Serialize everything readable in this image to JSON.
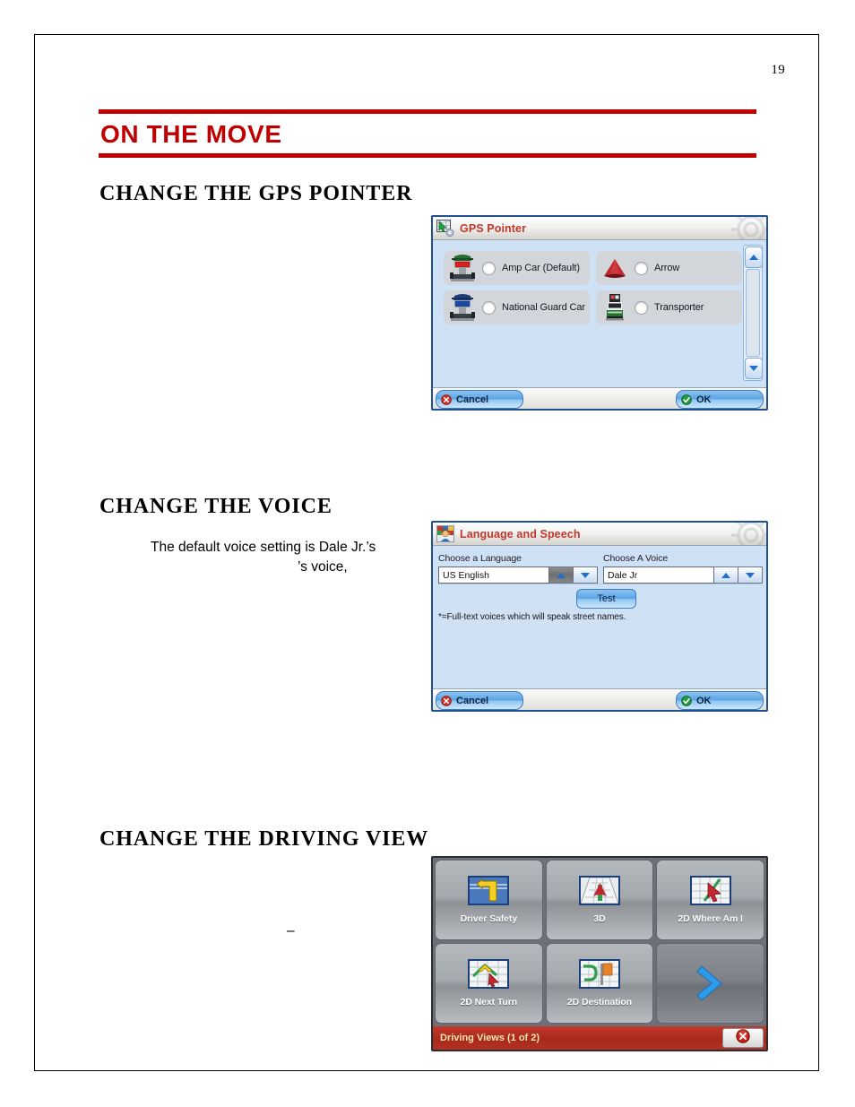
{
  "document": {
    "page_number": "19",
    "chapter_title": "ON THE MOVE",
    "sections": [
      {
        "heading": "CHANGE THE GPS POINTER"
      },
      {
        "heading": "CHANGE THE VOICE"
      },
      {
        "heading": "CHANGE THE DRIVING VIEW"
      }
    ],
    "body": {
      "voice_line_1": "The default voice setting is Dale Jr.’s",
      "voice_line_2": "’s voice,",
      "driving_view_dash": "–"
    },
    "accent_color": "#c00000",
    "rule_color": "#c00000"
  },
  "gps_pointer_dialog": {
    "title": "GPS Pointer",
    "title_icon": "map-pointer-gear-icon",
    "decoration_icon": "gear-icon",
    "options": [
      {
        "label": "Amp Car (Default)",
        "icon": "amp-car-icon",
        "selected": false
      },
      {
        "label": "Arrow",
        "icon": "red-arrow-icon",
        "selected": false
      },
      {
        "label": "National Guard Car",
        "icon": "national-guard-car-icon",
        "selected": false
      },
      {
        "label": "Transporter",
        "icon": "transporter-truck-icon",
        "selected": false
      }
    ],
    "scrollbar": {
      "up_icon": "chevron-up-icon",
      "down_icon": "chevron-down-icon"
    },
    "buttons": {
      "cancel": {
        "label": "Cancel",
        "icon": "red-x-icon"
      },
      "ok": {
        "label": "OK",
        "icon": "green-check-icon"
      }
    }
  },
  "language_speech_dialog": {
    "title": "Language and Speech",
    "title_icon": "person-headset-flags-icon",
    "decoration_icon": "gear-icon",
    "language_field": {
      "label": "Choose a Language",
      "value": "US English",
      "up_icon": "chevron-up-icon",
      "down_icon": "chevron-down-icon",
      "up_pressed": true
    },
    "voice_field": {
      "label": "Choose A Voice",
      "value": "Dale Jr",
      "up_icon": "chevron-up-icon",
      "down_icon": "chevron-down-icon",
      "up_pressed": false
    },
    "test_button": {
      "label": "Test"
    },
    "footnote": "*=Full-text voices which will speak street names.",
    "buttons": {
      "cancel": {
        "label": "Cancel",
        "icon": "red-x-icon"
      },
      "ok": {
        "label": "OK",
        "icon": "green-check-icon"
      }
    }
  },
  "driving_views_panel": {
    "tiles": [
      {
        "label": "Driver Safety",
        "icon": "turn-arrow-map-icon"
      },
      {
        "label": "3D",
        "icon": "3d-map-arrow-icon"
      },
      {
        "label": "2D Where Am I",
        "icon": "2d-map-cursor-icon"
      },
      {
        "label": "2D Next Turn",
        "icon": "2d-next-turn-map-icon"
      },
      {
        "label": "2D Destination",
        "icon": "2d-destination-flag-icon"
      },
      {
        "label": "",
        "icon": "next-page-arrow-icon"
      }
    ],
    "status_text": "Driving Views (1 of 2)",
    "close_button_icon": "red-x-close-icon",
    "status_bar_color": "#b33226",
    "status_text_color": "#f6e7b0"
  }
}
